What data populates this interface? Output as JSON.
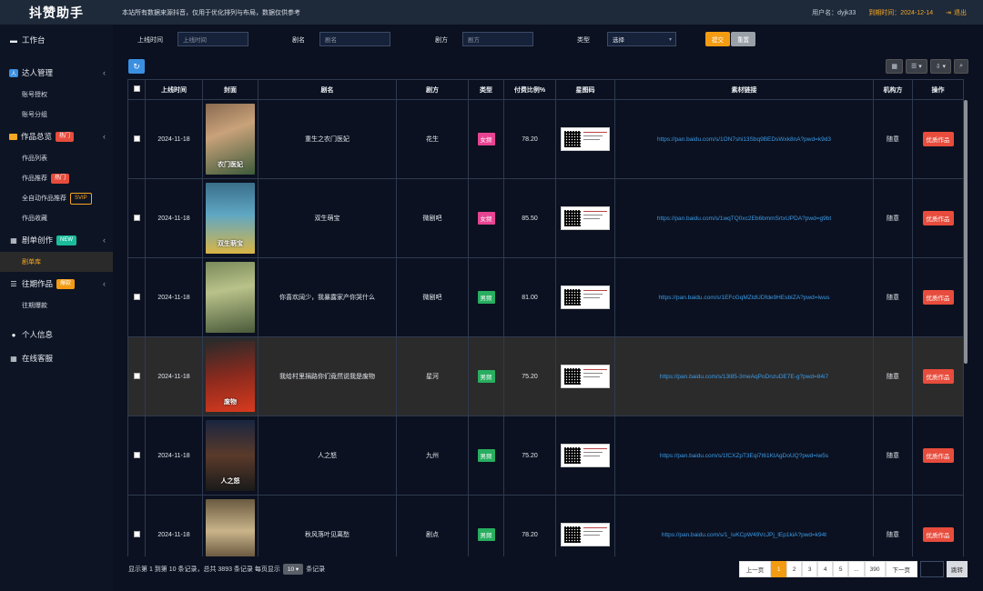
{
  "header": {
    "logo": "抖赞助手",
    "notice": "本站所有数据来源抖音，仅用于优化排列与布局，数据仅供参考",
    "user_label": "用户名：dyjk33",
    "expire_label": "到期时间：2024-12-14",
    "logout": "退出"
  },
  "sidebar": {
    "items": [
      {
        "label": "工作台",
        "icon": "monitor-icon"
      },
      {
        "label": "达人管理",
        "icon": "user-manage-icon"
      },
      {
        "label": "账号授权"
      },
      {
        "label": "账号分组"
      },
      {
        "label": "作品总览",
        "badge": "热门"
      },
      {
        "label": "作品列表"
      },
      {
        "label": "作品推荐",
        "badge": "热门"
      },
      {
        "label": "全自动作品推荐",
        "badge": "SVIP"
      },
      {
        "label": "作品收藏"
      },
      {
        "label": "剧单创作",
        "badge": "NEW"
      },
      {
        "label": "剧单库"
      },
      {
        "label": "往期作品",
        "badge": "爆款"
      },
      {
        "label": "往期爆款"
      },
      {
        "label": "个人信息"
      },
      {
        "label": "在线客服"
      }
    ]
  },
  "filters": {
    "date_label": "上线时间",
    "date_placeholder": "上线时间",
    "name_label": "剧名",
    "name_placeholder": "剧名",
    "party_label": "剧方",
    "party_placeholder": "剧方",
    "type_label": "类型",
    "type_value": "选择",
    "submit": "提交",
    "reset": "重置"
  },
  "table": {
    "headers": [
      "上线时间",
      "封面",
      "剧名",
      "剧方",
      "类型",
      "付费比例%",
      "星图码",
      "素材链接",
      "机构方",
      "操作"
    ],
    "rows": [
      {
        "date": "2024-11-18",
        "cover_text": "农门医妃",
        "name": "重生之农门医妃",
        "party": "花生",
        "type": "女频",
        "ratio": "78.20",
        "link": "https://pan.baidu.com/s/1ON7shi13Sbq9BEDsWxk8nA?pwd=k9d3",
        "org": "随意",
        "action": "优质作品"
      },
      {
        "date": "2024-11-18",
        "cover_text": "双生萌宝",
        "name": "双生萌宝",
        "party": "微剧吧",
        "type": "女频",
        "ratio": "85.50",
        "link": "https://pan.baidu.com/s/1wqTQ0xc2Eb6bmmSrtxUPDA?pwd=g9bt",
        "org": "随意",
        "action": "优质作品"
      },
      {
        "date": "2024-11-18",
        "cover_text": "",
        "name": "你喜欢阔少，我暴露家产你哭什么",
        "party": "微剧吧",
        "type": "男频",
        "ratio": "81.00",
        "link": "https://pan.baidu.com/s/1EFcGqMZtdUDfde9HEsbIZA?pwd=lwus",
        "org": "随意",
        "action": "优质作品"
      },
      {
        "date": "2024-11-18",
        "cover_text": "废物",
        "name": "我给村里捐路你们竟然说我是废物",
        "party": "星河",
        "type": "男频",
        "ratio": "75.20",
        "link": "https://pan.baidu.com/s/13l85-3meAqPoDnzuDE7E-g?pwd=84i7",
        "org": "随意",
        "action": "优质作品"
      },
      {
        "date": "2024-11-18",
        "cover_text": "人之怒",
        "name": "人之怒",
        "party": "九州",
        "type": "男频",
        "ratio": "75.20",
        "link": "https://pan.baidu.com/s/1fCXZpT3Eqi7t61KtAgDoUQ?pwd=iw5s",
        "org": "随意",
        "action": "优质作品"
      },
      {
        "date": "2024-11-18",
        "cover_text": "",
        "name": "秋风落叶见离愁",
        "party": "剧点",
        "type": "男频",
        "ratio": "78.20",
        "link": "https://pan.baidu.com/s/1_luKCpW49VcJPj_lEp1kiA?pwd=k94t",
        "org": "随意",
        "action": "优质作品"
      }
    ]
  },
  "pagination": {
    "summary_prefix": "显示第 1 到第 10 条记录，总共 3893 条记录 每页显示",
    "page_size": "10 ▾",
    "summary_suffix": "条记录",
    "prev": "上一页",
    "pages": [
      "1",
      "2",
      "3",
      "4",
      "5",
      "...",
      "390"
    ],
    "next": "下一页",
    "jump": "跳转"
  },
  "colors": {
    "accent": "#f39c12",
    "female_tag": "#e84393",
    "male_tag": "#27ae60",
    "link": "#3b9be8",
    "danger": "#e74c3c"
  }
}
